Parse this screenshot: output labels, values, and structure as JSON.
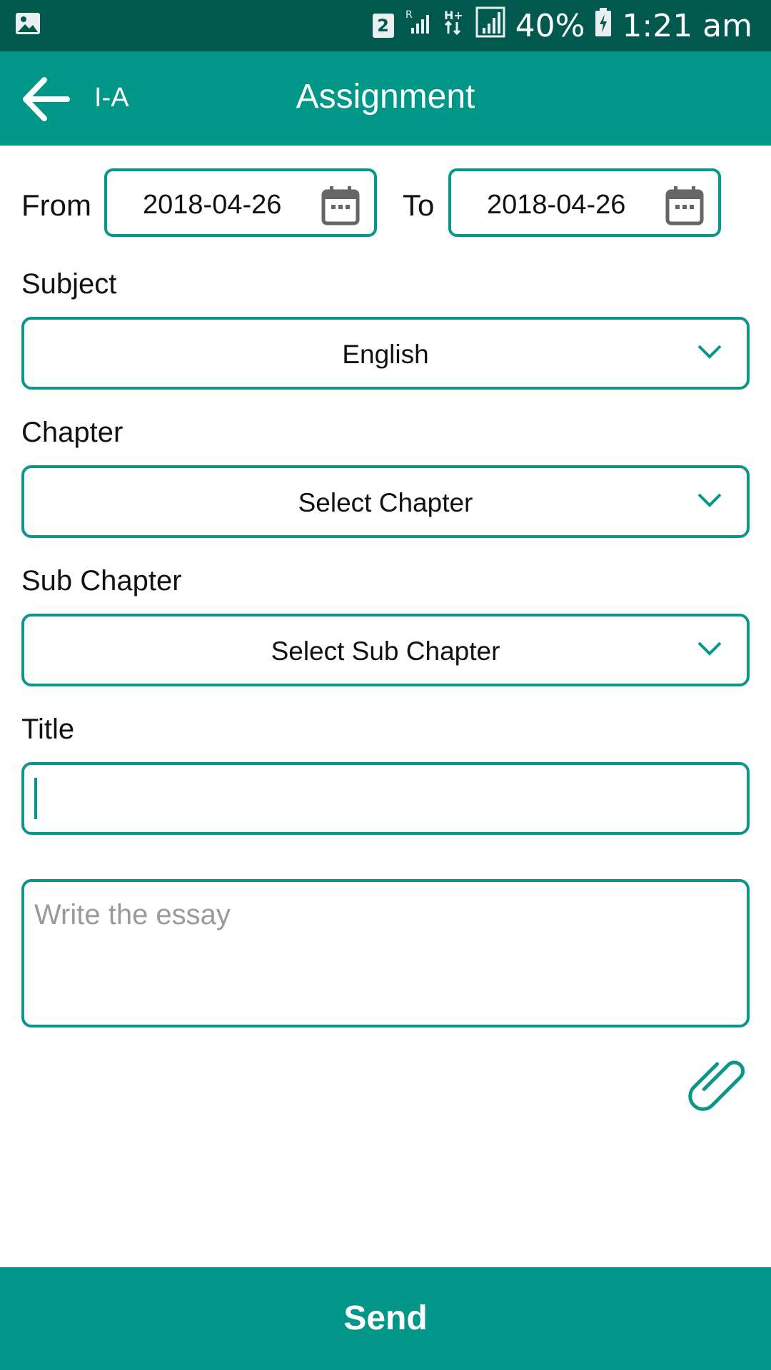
{
  "status_bar": {
    "sim_slot": "2",
    "battery": "40%",
    "time": "1:21 am",
    "icons": [
      "gallery-notification-icon",
      "signal-roaming-icon",
      "hplus-data-icon",
      "signal-strength-icon",
      "battery-charging-icon"
    ]
  },
  "app_bar": {
    "class_label": "I-A",
    "title": "Assignment",
    "back_icon": "arrow-left-icon"
  },
  "date_range": {
    "from_label": "From",
    "from_value": "2018-04-26",
    "to_label": "To",
    "to_value": "2018-04-26",
    "icon": "calendar-icon"
  },
  "subject": {
    "label": "Subject",
    "selected": "English"
  },
  "chapter": {
    "label": "Chapter",
    "selected": "Select Chapter"
  },
  "sub_chapter": {
    "label": "Sub Chapter",
    "selected": "Select Sub Chapter"
  },
  "title_field": {
    "label": "Title",
    "value": ""
  },
  "essay_field": {
    "placeholder": "Write the essay",
    "value": ""
  },
  "attach": {
    "icon": "paperclip-icon"
  },
  "send_button": {
    "label": "Send"
  },
  "colors": {
    "primary": "#009688",
    "primary_dark": "#00584e",
    "border": "#0a9688",
    "placeholder": "#9a9a9a"
  }
}
